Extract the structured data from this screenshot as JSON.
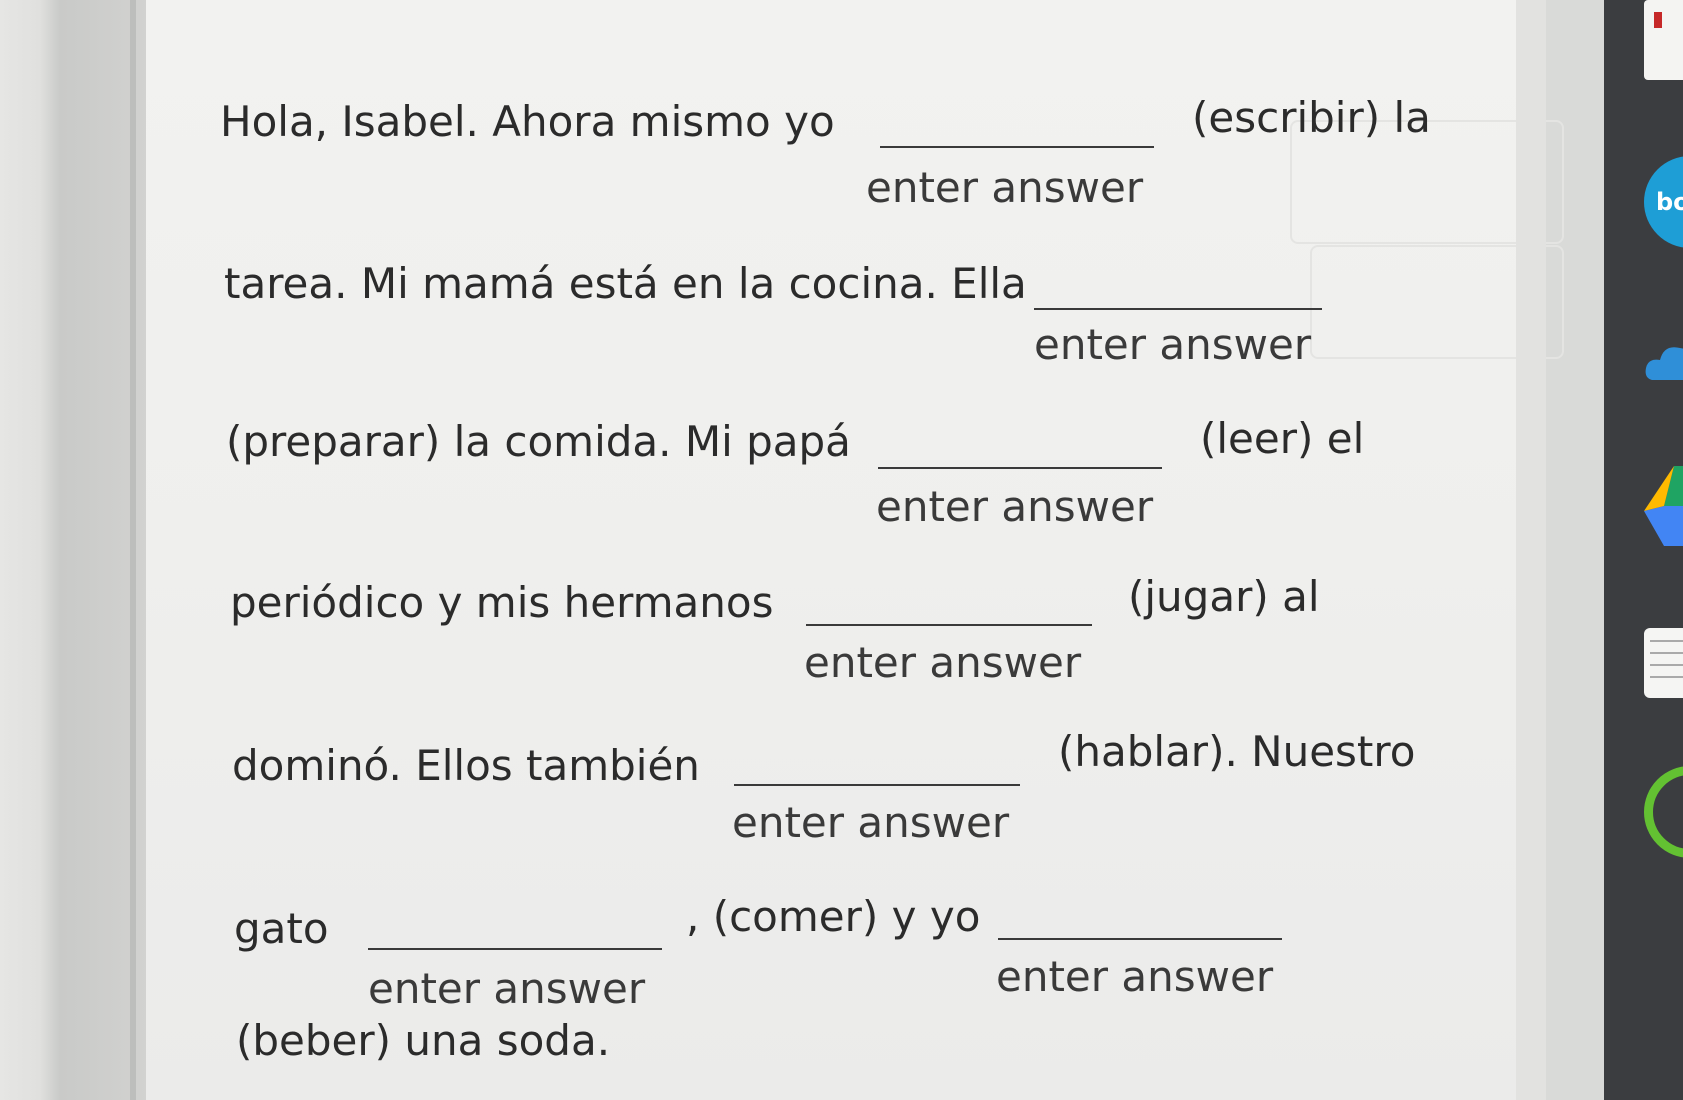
{
  "exercise": {
    "segments": [
      "Hola, Isabel. Ahora mismo yo",
      "(escribir) la",
      "tarea. Mi mamá está en la cocina. Ella",
      "(preparar) la comida. Mi papá",
      "(leer) el",
      "periódico y mis hermanos",
      "(jugar) al",
      "dominó. Ellos también",
      "(hablar). Nuestro",
      "gato",
      ", (comer) y yo",
      "(beber) una soda."
    ],
    "blanks": [
      {
        "value": "",
        "placeholder": "enter answer"
      },
      {
        "value": "",
        "placeholder": "enter answer"
      },
      {
        "value": "",
        "placeholder": "enter answer"
      },
      {
        "value": "",
        "placeholder": "enter answer"
      },
      {
        "value": "",
        "placeholder": "enter answer"
      },
      {
        "value": "",
        "placeholder": "enter answer"
      },
      {
        "value": "",
        "placeholder": "enter answer"
      }
    ]
  },
  "dock": {
    "items": [
      "bookmark-icon",
      "bo-app-icon",
      "cloud-icon",
      "drive-icon",
      "notes-icon",
      "green-ring-app-icon"
    ],
    "colors": {
      "bookmark": "#c62828",
      "bo_app": "#1e9ed6",
      "cloud": "#2f8fd8",
      "drive_green": "#1fa463",
      "drive_blue": "#4285f4",
      "ring": "#63c132"
    }
  }
}
